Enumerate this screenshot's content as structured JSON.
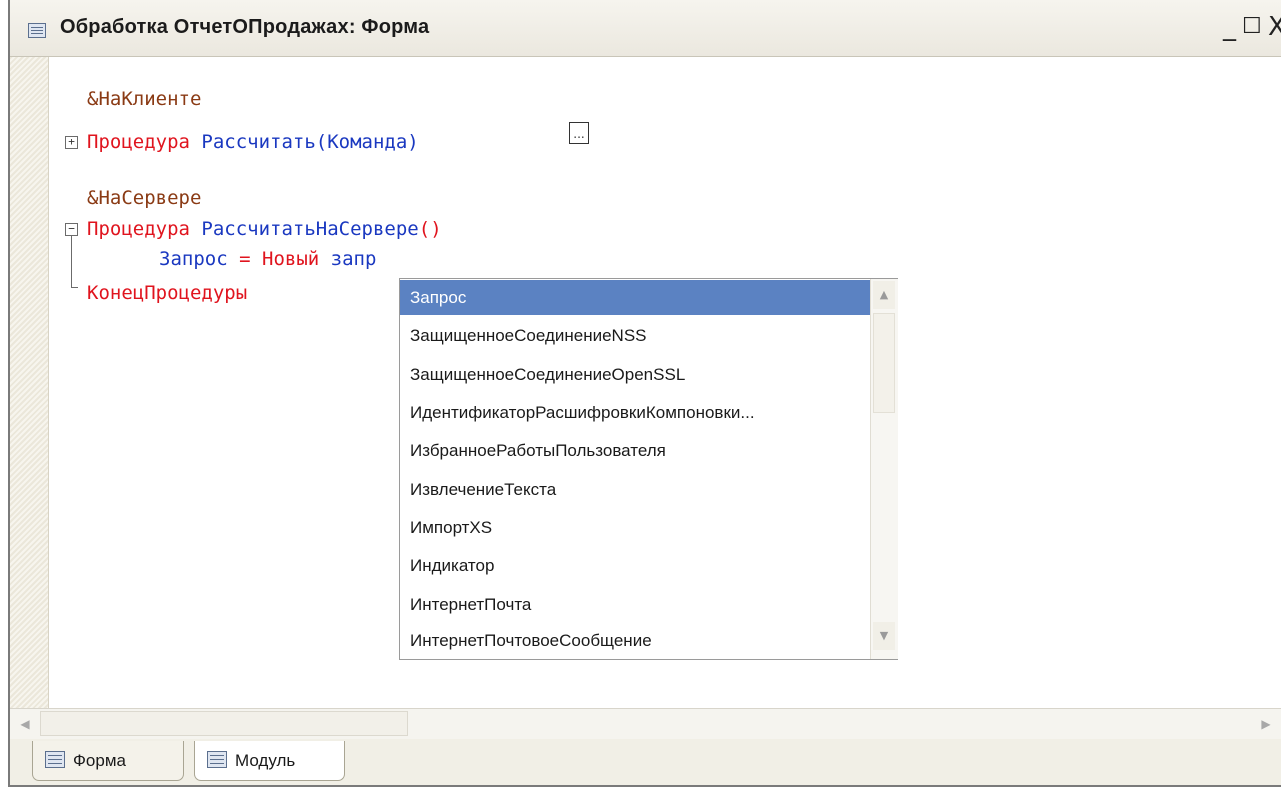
{
  "window": {
    "title": "Обработка ОтчетОПродажах: Форма",
    "minimize_label": "_",
    "maximize_label": "☐",
    "close_label": "X"
  },
  "code": {
    "lines": [
      {
        "text": "&НаКлиенте"
      },
      {
        "kw": "Процедура",
        "name": "Рассчитать",
        "args": "(Команда)"
      },
      {
        "text": "&НаСервере"
      },
      {
        "kw": "Процедура",
        "name": "РассчитатьНаСервере",
        "args": "()"
      },
      {
        "var": "Запрос",
        "op": "=",
        "kw": "Новый",
        "typed": "запр"
      },
      {
        "kw": "КонецПроцедуры"
      }
    ],
    "collapsed_marker": "..."
  },
  "autocomplete": {
    "items": [
      "Запрос",
      "ЗащищенноеСоединениеNSS",
      "ЗащищенноеСоединениеOpenSSL",
      "ИдентификаторРасшифровкиКомпоновки...",
      "ИзбранноеРаботыПользователя",
      "ИзвлечениеТекста",
      "ИмпортXS",
      "Индикатор",
      "ИнтернетПочта",
      "ИнтернетПочтовоеСообщение"
    ],
    "selected_index": 0,
    "up_icon": "▲",
    "down_icon": "▼"
  },
  "scrollbar": {
    "left_icon": "◀",
    "right_icon": "▶"
  },
  "tabs": [
    {
      "label": "Форма",
      "icon": "form-icon"
    },
    {
      "label": "Модуль",
      "icon": "module-icon",
      "active": true
    }
  ],
  "colors": {
    "keyword": "#e0141e",
    "identifier": "#1a38c0",
    "preprocessor": "#8a3a14",
    "selection": "#5b82c2"
  }
}
